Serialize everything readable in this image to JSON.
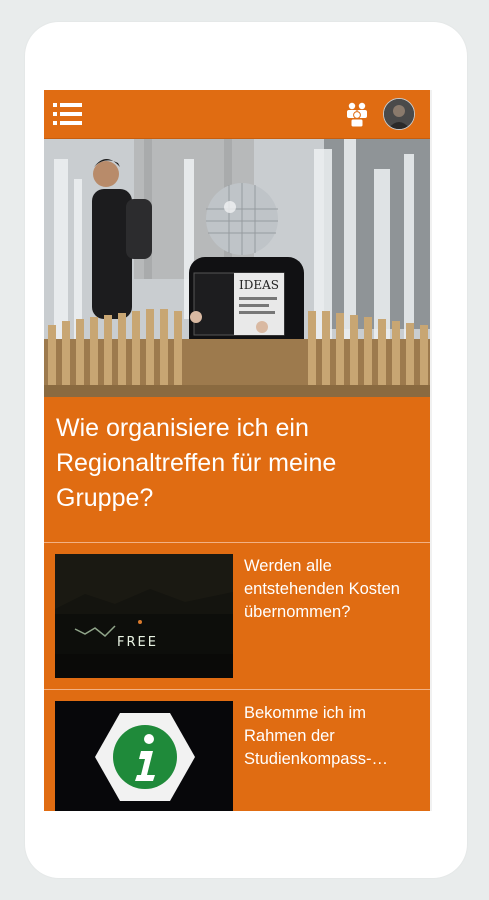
{
  "header": {
    "menu_icon": "hamburger-menu-icon",
    "groups_icon": "groups-icon",
    "avatar_icon": "user-avatar",
    "brand_color": "#e06c12"
  },
  "hero": {
    "image_icon": "photo-man-with-disco-ball-head-reading-ideas-magazine",
    "magazine_text": "IDEAS",
    "title": "Wie organisiere ich ein Regionaltreffen für meine Gruppe?"
  },
  "articles": [
    {
      "image_icon": "photo-light-painting-free",
      "image_text": "FREE",
      "title": "Werden alle entstehenden Kosten übernommen?"
    },
    {
      "image_icon": "photo-info-sign",
      "title": "Bekomme ich im Rahmen der Studienkompass-…"
    }
  ],
  "scrollbar": {
    "up_icon": "▲",
    "down_icon": "▼"
  }
}
